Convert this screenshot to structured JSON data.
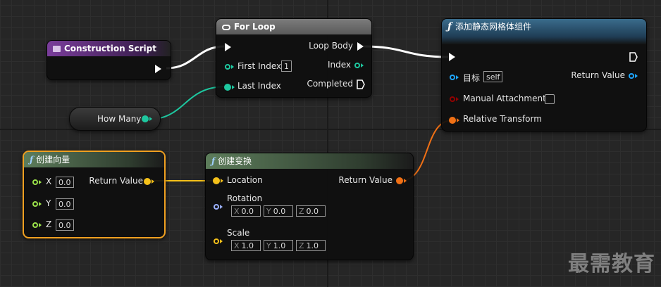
{
  "nodes": {
    "construction": {
      "title": "Construction Script"
    },
    "forloop": {
      "title": "For Loop",
      "first_index_label": "First Index",
      "first_index_value": "1",
      "last_index_label": "Last Index",
      "loop_body_label": "Loop Body",
      "index_label": "Index",
      "completed_label": "Completed"
    },
    "howmany": {
      "label": "How Many"
    },
    "addmesh": {
      "title": "添加静态网格体组件",
      "target_label": "目标",
      "target_value": "self",
      "manual_attachment_label": "Manual Attachment",
      "relative_transform_label": "Relative Transform",
      "return_value_label": "Return Value"
    },
    "makevector": {
      "title": "创建向量",
      "x_label": "X",
      "x_value": "0.0",
      "y_label": "Y",
      "y_value": "0.0",
      "z_label": "Z",
      "z_value": "0.0",
      "return_value_label": "Return Value"
    },
    "maketransform": {
      "title": "创建变换",
      "location_label": "Location",
      "rotation_label": "Rotation",
      "rotation": {
        "x": "0.0",
        "y": "0.0",
        "z": "0.0"
      },
      "scale_label": "Scale",
      "scale": {
        "x": "1.0",
        "y": "1.0",
        "z": "1.0"
      },
      "return_value_label": "Return Value",
      "axis_x": "X",
      "axis_y": "Y",
      "axis_z": "Z"
    }
  },
  "watermark": "最需教育",
  "colors": {
    "construction_header": "#6b3a8c",
    "forloop_header": "#6a6a6a",
    "function_header": "#2f5d7a",
    "pure_header": "#4a6b48",
    "wire_exec": "#ffffff",
    "wire_int": "#1ec8a0",
    "wire_vector": "#f5c11a",
    "wire_transform": "#f07015",
    "pin_object": "#1ea5ff",
    "pin_bool": "#920101",
    "pin_rotator": "#9ab0ff",
    "selected_border": "#f0a020"
  }
}
